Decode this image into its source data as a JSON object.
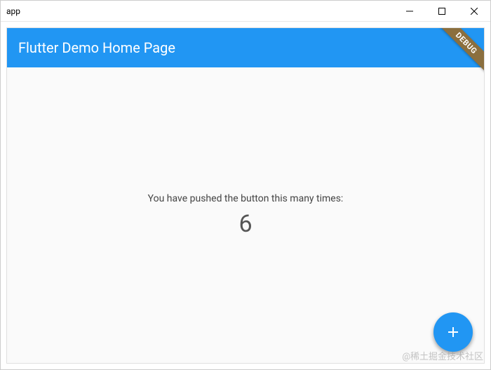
{
  "window": {
    "title": "app"
  },
  "appbar": {
    "title": "Flutter Demo Home Page"
  },
  "debug_banner": {
    "label": "DEBUG"
  },
  "body": {
    "prompt_text": "You have pushed the button this many times:",
    "counter_value": "6"
  },
  "fab": {
    "icon_name": "add"
  },
  "watermark": {
    "text": "@稀土掘金技术社区"
  }
}
